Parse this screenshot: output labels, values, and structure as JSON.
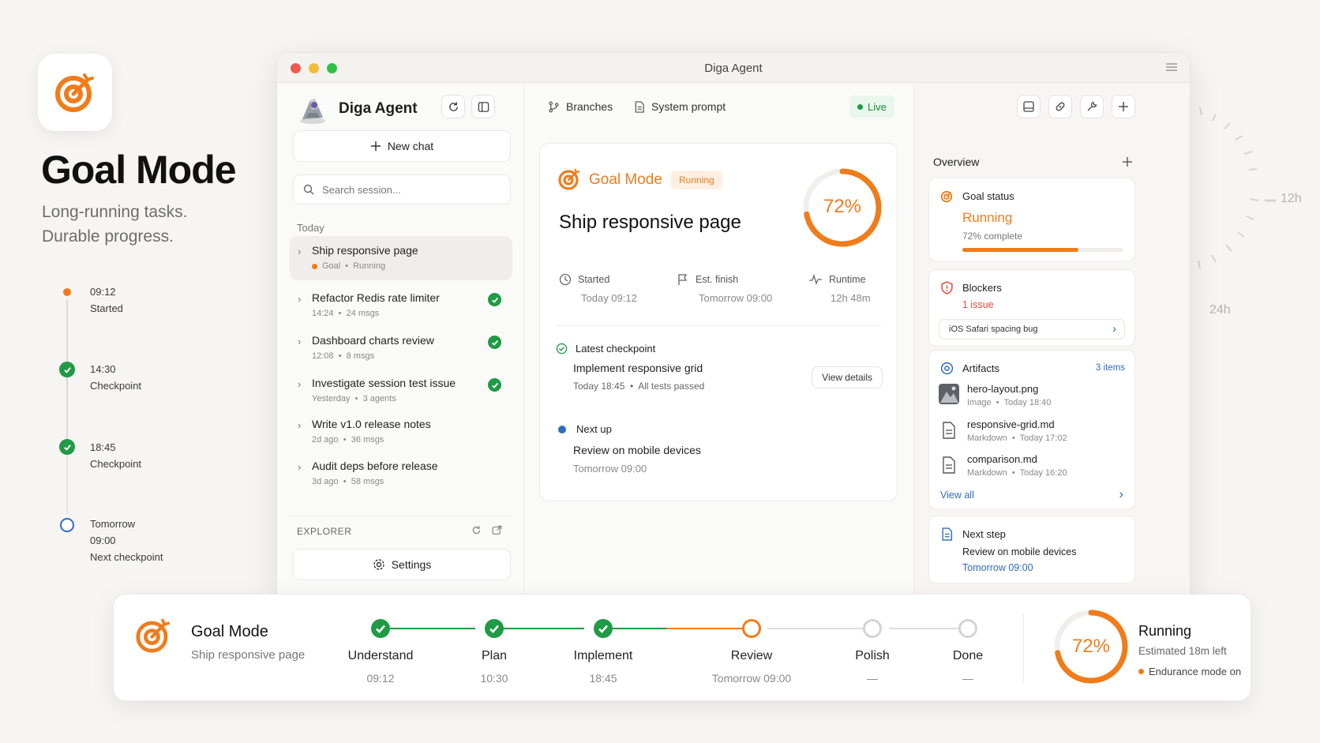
{
  "hero": {
    "title": "Goal Mode",
    "subtitle_line1": "Long-running tasks.",
    "subtitle_line2": "Durable progress.",
    "timeline": [
      {
        "time": "09:12",
        "label": "Started"
      },
      {
        "time": "14:30",
        "label": "Checkpoint"
      },
      {
        "time": "18:45",
        "label": "Checkpoint"
      },
      {
        "time": "Tomorrow",
        "time2": "09:00",
        "label": "Next checkpoint"
      }
    ],
    "dial_labels": {
      "a": "12h",
      "b": "24h"
    }
  },
  "window": {
    "title": "Diga Agent"
  },
  "sidebar": {
    "brand": "Diga Agent",
    "new_chat": "New chat",
    "search_placeholder": "Search session...",
    "section": "Today",
    "sessions": [
      {
        "title": "Ship responsive page",
        "tag": "Goal",
        "status": "Running"
      },
      {
        "title": "Refactor Redis rate limiter",
        "meta1": "14:24",
        "meta2": "24 msgs"
      },
      {
        "title": "Dashboard charts review",
        "meta1": "12:08",
        "meta2": "8 msgs"
      },
      {
        "title": "Investigate session test issue",
        "meta1": "Yesterday",
        "meta2": "3 agents"
      },
      {
        "title": "Write v1.0 release notes",
        "meta1": "2d ago",
        "meta2": "36 msgs"
      },
      {
        "title": "Audit deps before release",
        "meta1": "3d ago",
        "meta2": "58 msgs"
      }
    ],
    "explorer": "EXPLORER",
    "settings": "Settings"
  },
  "main": {
    "branches": "Branches",
    "system_prompt": "System prompt",
    "live": "Live",
    "goal_label": "Goal Mode",
    "status_pill": "Running",
    "task_title": "Ship responsive page",
    "progress_text": "72%",
    "progress": 0.72,
    "stats": [
      {
        "label": "Started",
        "value": "Today 09:12"
      },
      {
        "label": "Est. finish",
        "value": "Tomorrow 09:00"
      },
      {
        "label": "Runtime",
        "value": "12h 48m"
      }
    ],
    "checkpoint": {
      "label": "Latest checkpoint",
      "title": "Implement responsive grid",
      "time": "Today 18:45",
      "note": "All tests passed",
      "button": "View details"
    },
    "next": {
      "label": "Next up",
      "title": "Review on mobile devices",
      "time": "Tomorrow 09:00"
    }
  },
  "panel": {
    "overview": "Overview",
    "goal_status": {
      "title": "Goal status",
      "status": "Running",
      "complete": "72% complete",
      "progress": 0.72
    },
    "blockers": {
      "title": "Blockers",
      "count": "1 issue",
      "issue": "iOS Safari spacing bug"
    },
    "artifacts": {
      "title": "Artifacts",
      "count": "3 items",
      "items": [
        {
          "name": "hero-layout.png",
          "type": "Image",
          "time": "Today 18:40"
        },
        {
          "name": "responsive-grid.md",
          "type": "Markdown",
          "time": "Today 17:02"
        },
        {
          "name": "comparison.md",
          "type": "Markdown",
          "time": "Today 16:20"
        }
      ],
      "view_all": "View all"
    },
    "next_step": {
      "title": "Next step",
      "task": "Review on mobile devices",
      "time": "Tomorrow 09:00"
    }
  },
  "bottom": {
    "title": "Goal Mode",
    "subtitle": "Ship responsive page",
    "steps": [
      {
        "name": "Understand",
        "time": "09:12",
        "state": "done"
      },
      {
        "name": "Plan",
        "time": "10:30",
        "state": "done"
      },
      {
        "name": "Implement",
        "time": "18:45",
        "state": "done"
      },
      {
        "name": "Review",
        "time": "Tomorrow 09:00",
        "state": "current"
      },
      {
        "name": "Polish",
        "time": "—",
        "state": "pending"
      },
      {
        "name": "Done",
        "time": "—",
        "state": "pending"
      }
    ],
    "progress_text": "72%",
    "progress": 0.72,
    "status": "Running",
    "estimate": "Estimated 18m left",
    "endurance": "Endurance mode on"
  },
  "colors": {
    "accent": "#f07c1a",
    "success": "#1f9a45",
    "link": "#2f6bc4",
    "danger": "#e14a3b"
  }
}
